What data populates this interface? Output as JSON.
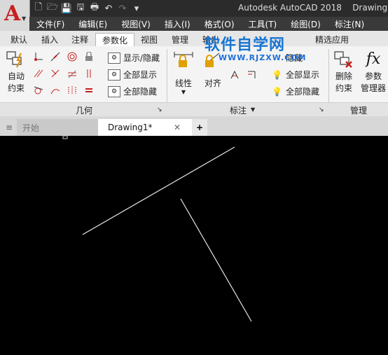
{
  "app": {
    "title": "Autodesk AutoCAD 2018",
    "document": "Drawing1"
  },
  "quick_access": [
    "new-icon",
    "open-icon",
    "save-icon",
    "saveas-icon",
    "print-icon",
    "undo-icon",
    "redo-icon",
    "dropdown-icon"
  ],
  "menu": [
    "文件(F)",
    "编辑(E)",
    "视图(V)",
    "插入(I)",
    "格式(O)",
    "工具(T)",
    "绘图(D)",
    "标注(N)"
  ],
  "ribbon_tabs": [
    "默认",
    "插入",
    "注释",
    "参数化",
    "视图",
    "管理",
    "输出",
    "精选应用"
  ],
  "active_ribbon_tab": "参数化",
  "geometry_panel": {
    "auto_btn_line1": "自动",
    "auto_btn_line2": "约束",
    "show_hide": "显示/隐藏",
    "show_all": "全部显示",
    "hide_all": "全部隐藏",
    "label": "几何"
  },
  "dimension_panel": {
    "linear": "线性",
    "aligned": "对齐",
    "show_hide": "隐藏",
    "show_all": "全部显示",
    "hide_all": "全部隐藏",
    "label": "标注"
  },
  "manage_panel": {
    "delete_line1": "删除",
    "delete_line2": "约束",
    "params_line1": "参数",
    "params_line2": "管理器",
    "label": "管理"
  },
  "file_tabs": {
    "start": "开始",
    "drawing": "Drawing1*",
    "add": "+"
  },
  "watermark": {
    "main": "软件自学网",
    "sub": "WWW.RJZXW.COM"
  },
  "colors": {
    "accent_red": "#c8201e",
    "line": "#e8e8e8",
    "canvas": "#000000"
  }
}
